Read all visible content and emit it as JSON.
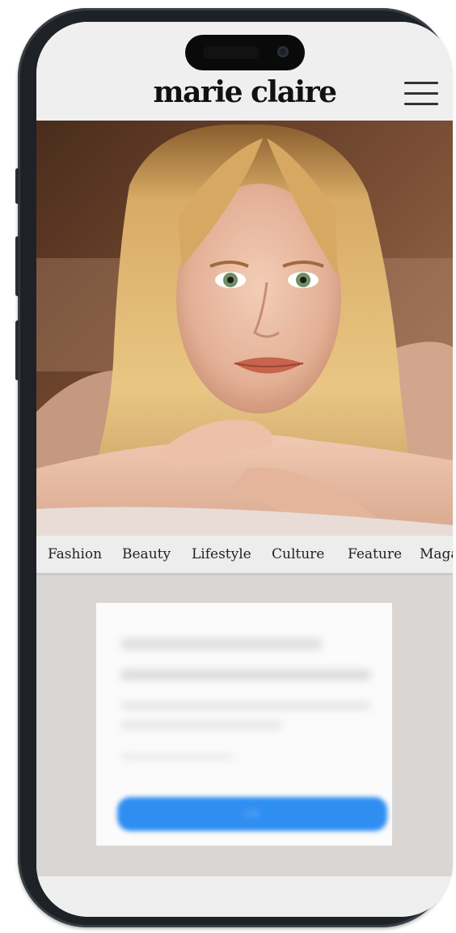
{
  "header": {
    "brand": "marie claire",
    "menu_icon": "hamburger-menu-icon"
  },
  "hero": {
    "description_icon": "portrait-photo"
  },
  "nav": {
    "items": [
      "Fashion",
      "Beauty",
      "Lifestyle",
      "Culture",
      "Feature",
      "Maga"
    ]
  },
  "ad": {
    "cta_label": "OK"
  },
  "colors": {
    "screen_bg": "#efefef",
    "content_bg": "#d9d6d3",
    "cta_blue": "#2f8ef2",
    "frame": "#1e2126"
  }
}
